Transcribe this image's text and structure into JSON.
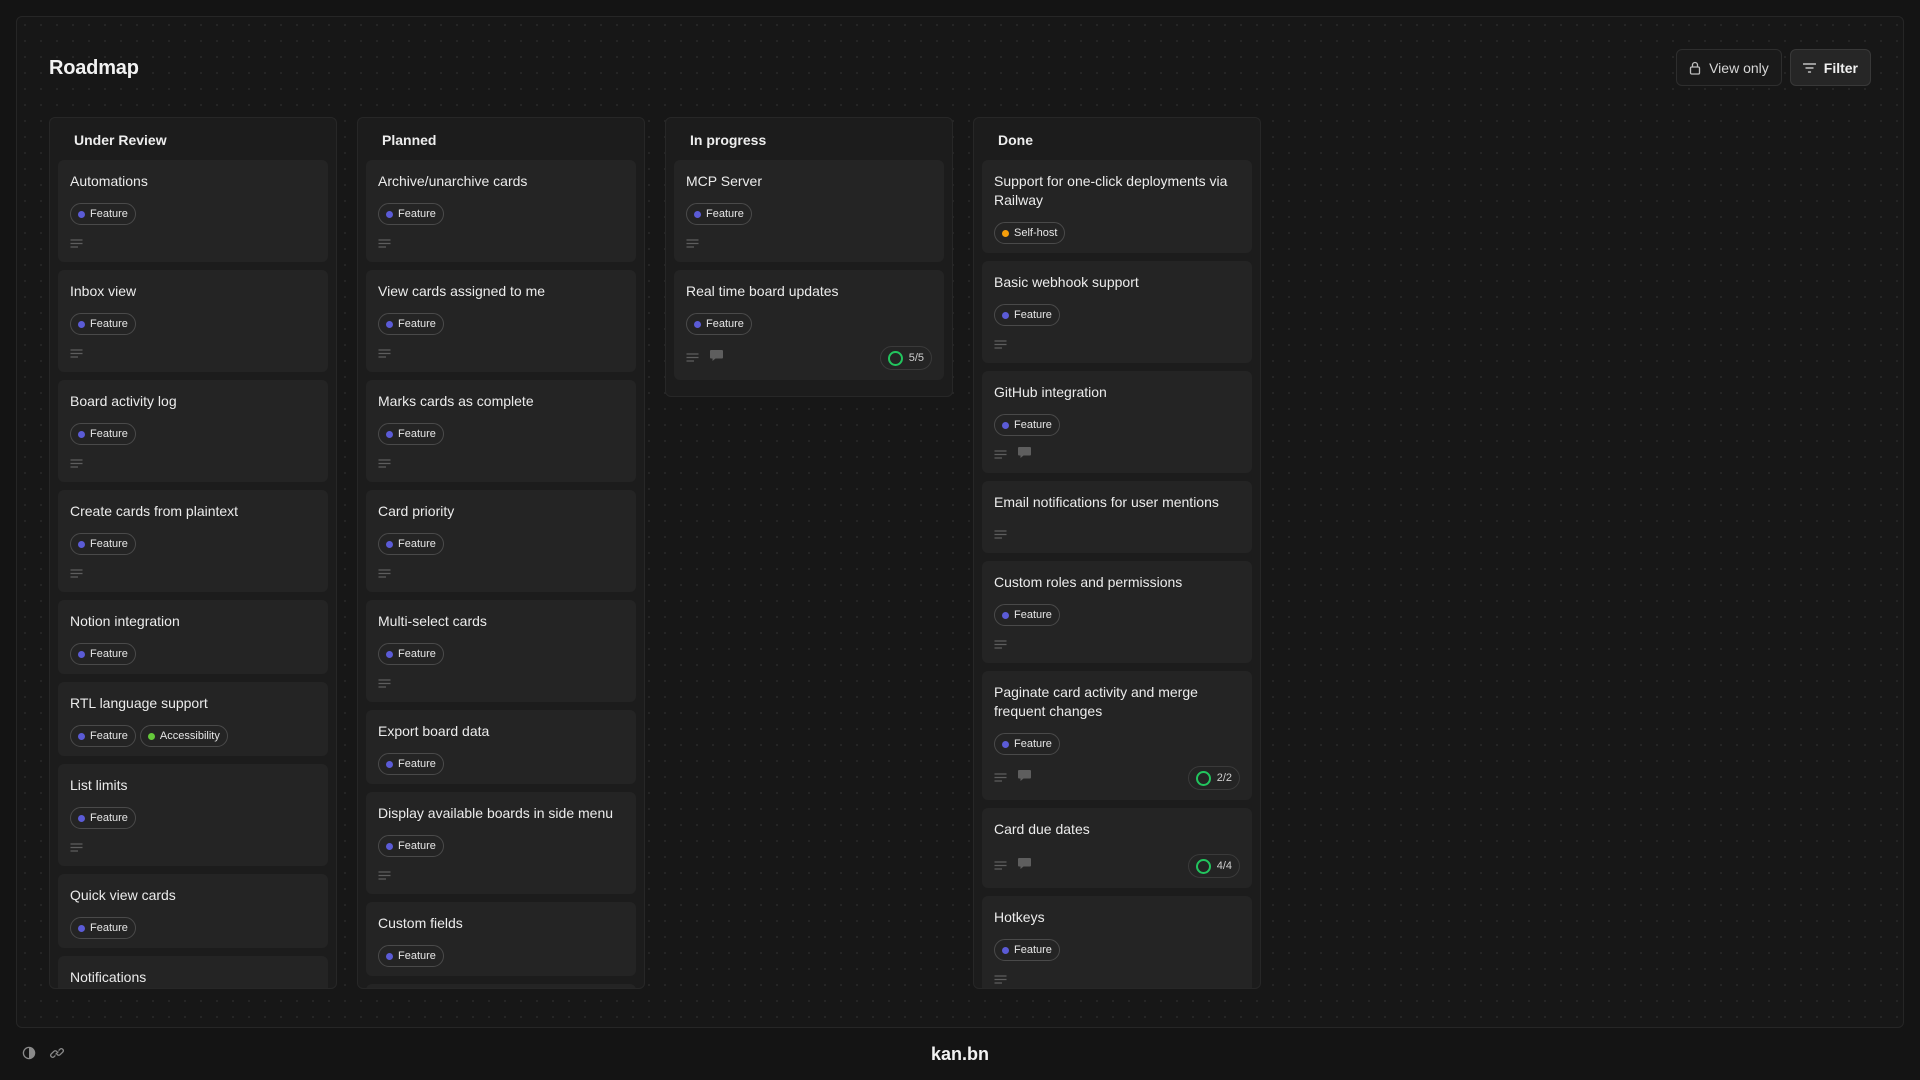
{
  "page": {
    "title": "Roadmap",
    "view_only_label": "View only",
    "filter_label": "Filter"
  },
  "colors": {
    "feature": "#5b5bd6",
    "self_host": "#f59e0b",
    "accessibility": "#65c93a",
    "progress_ring": "#22c55e"
  },
  "columns": [
    {
      "title": "Under Review",
      "cards": [
        {
          "title": "Automations",
          "labels": [
            {
              "text": "Feature",
              "color": "feature"
            }
          ],
          "description": true,
          "comments": false
        },
        {
          "title": "Inbox view",
          "labels": [
            {
              "text": "Feature",
              "color": "feature"
            }
          ],
          "description": true,
          "comments": false
        },
        {
          "title": "Board activity log",
          "labels": [
            {
              "text": "Feature",
              "color": "feature"
            }
          ],
          "description": true,
          "comments": false
        },
        {
          "title": "Create cards from plaintext",
          "labels": [
            {
              "text": "Feature",
              "color": "feature"
            }
          ],
          "description": true,
          "comments": false
        },
        {
          "title": "Notion integration",
          "labels": [
            {
              "text": "Feature",
              "color": "feature"
            }
          ],
          "description": false,
          "comments": false
        },
        {
          "title": "RTL language support",
          "labels": [
            {
              "text": "Feature",
              "color": "feature"
            },
            {
              "text": "Accessibility",
              "color": "accessibility"
            }
          ],
          "description": false,
          "comments": false
        },
        {
          "title": "List limits",
          "labels": [
            {
              "text": "Feature",
              "color": "feature"
            }
          ],
          "description": true,
          "comments": false
        },
        {
          "title": "Quick view cards",
          "labels": [
            {
              "text": "Feature",
              "color": "feature"
            }
          ],
          "description": false,
          "comments": false
        },
        {
          "title": "Notifications",
          "labels": [],
          "description": false,
          "comments": false
        }
      ]
    },
    {
      "title": "Planned",
      "cards": [
        {
          "title": "Archive/unarchive cards",
          "labels": [
            {
              "text": "Feature",
              "color": "feature"
            }
          ],
          "description": true,
          "comments": false
        },
        {
          "title": "View cards assigned to me",
          "labels": [
            {
              "text": "Feature",
              "color": "feature"
            }
          ],
          "description": true,
          "comments": false
        },
        {
          "title": "Marks cards as complete",
          "labels": [
            {
              "text": "Feature",
              "color": "feature"
            }
          ],
          "description": true,
          "comments": false
        },
        {
          "title": "Card priority",
          "labels": [
            {
              "text": "Feature",
              "color": "feature"
            }
          ],
          "description": true,
          "comments": false
        },
        {
          "title": "Multi-select cards",
          "labels": [
            {
              "text": "Feature",
              "color": "feature"
            }
          ],
          "description": true,
          "comments": false
        },
        {
          "title": "Export board data",
          "labels": [
            {
              "text": "Feature",
              "color": "feature"
            }
          ],
          "description": false,
          "comments": false
        },
        {
          "title": "Display available boards in side menu",
          "labels": [
            {
              "text": "Feature",
              "color": "feature"
            }
          ],
          "description": true,
          "comments": false
        },
        {
          "title": "Custom fields",
          "labels": [
            {
              "text": "Feature",
              "color": "feature"
            }
          ],
          "description": false,
          "comments": false
        },
        {
          "title": "",
          "labels": [],
          "description": false,
          "comments": false
        }
      ]
    },
    {
      "title": "In progress",
      "cards": [
        {
          "title": "MCP Server",
          "labels": [
            {
              "text": "Feature",
              "color": "feature"
            }
          ],
          "description": true,
          "comments": false
        },
        {
          "title": "Real time board updates",
          "labels": [
            {
              "text": "Feature",
              "color": "feature"
            }
          ],
          "description": true,
          "comments": true,
          "progress": "5/5"
        }
      ]
    },
    {
      "title": "Done",
      "cards": [
        {
          "title": "Support for one-click deployments via Railway",
          "labels": [
            {
              "text": "Self-host",
              "color": "self_host"
            }
          ],
          "description": false,
          "comments": false
        },
        {
          "title": "Basic webhook support",
          "labels": [
            {
              "text": "Feature",
              "color": "feature"
            }
          ],
          "description": true,
          "comments": false
        },
        {
          "title": "GitHub integration",
          "labels": [
            {
              "text": "Feature",
              "color": "feature"
            }
          ],
          "description": true,
          "comments": true
        },
        {
          "title": "Email notifications for user mentions",
          "labels": [],
          "description": true,
          "comments": false
        },
        {
          "title": "Custom roles and permissions",
          "labels": [
            {
              "text": "Feature",
              "color": "feature"
            }
          ],
          "description": true,
          "comments": false
        },
        {
          "title": "Paginate card activity and merge frequent changes",
          "labels": [
            {
              "text": "Feature",
              "color": "feature"
            }
          ],
          "description": true,
          "comments": true,
          "progress": "2/2"
        },
        {
          "title": "Card due dates",
          "labels": [],
          "description": true,
          "comments": true,
          "progress": "4/4"
        },
        {
          "title": "Hotkeys",
          "labels": [
            {
              "text": "Feature",
              "color": "feature"
            }
          ],
          "description": true,
          "comments": false
        }
      ]
    }
  ],
  "footer": {
    "brand": "kan.bn",
    "icons": [
      "theme-toggle-icon",
      "link-icon"
    ]
  }
}
